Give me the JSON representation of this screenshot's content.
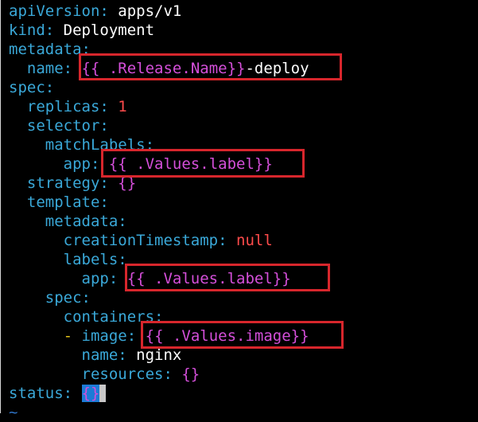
{
  "editor": {
    "lines": [
      {
        "key": "apiVersion",
        "sep": ": ",
        "value": "apps/v1"
      },
      {
        "key": "kind",
        "sep": ": ",
        "value": "Deployment"
      },
      {
        "key": "metadata",
        "sep": ":"
      },
      {
        "indent": "  ",
        "key": "name",
        "sep": ": ",
        "tpl": "{{ .Release.Name}}",
        "suffix": "-deploy"
      },
      {
        "key": "spec",
        "sep": ":"
      },
      {
        "indent": "  ",
        "key": "replicas",
        "sep": ": ",
        "num": "1"
      },
      {
        "indent": "  ",
        "key": "selector",
        "sep": ":"
      },
      {
        "indent": "    ",
        "key": "matchLabels",
        "sep": ":"
      },
      {
        "indent": "      ",
        "key": "app",
        "sep": ": ",
        "tpl": "{{ .Values.label}}"
      },
      {
        "indent": "  ",
        "key": "strategy",
        "sep": ": ",
        "braces": "{}"
      },
      {
        "indent": "  ",
        "key": "template",
        "sep": ":"
      },
      {
        "indent": "    ",
        "key": "metadata",
        "sep": ":"
      },
      {
        "indent": "      ",
        "key": "creationTimestamp",
        "sep": ": ",
        "nullval": "null"
      },
      {
        "indent": "      ",
        "key": "labels",
        "sep": ":"
      },
      {
        "indent": "        ",
        "key": "app",
        "sep": ": ",
        "tpl": "{{ .Values.label}}"
      },
      {
        "indent": "    ",
        "key": "spec",
        "sep": ":"
      },
      {
        "indent": "      ",
        "key": "containers",
        "sep": ":"
      },
      {
        "indent": "      ",
        "dash": "- ",
        "key": "image",
        "sep": ": ",
        "tpl": "{{ .Values.image}}"
      },
      {
        "indent": "        ",
        "key": "name",
        "sep": ": ",
        "value": "nginx"
      },
      {
        "indent": "        ",
        "key": "resources",
        "sep": ": ",
        "braces": "{}"
      },
      {
        "key": "status",
        "sep": ": ",
        "cursor": "{}"
      },
      {
        "tilde": "~"
      }
    ]
  },
  "colors": {
    "background": "#000000",
    "key": "#3aa8d8",
    "template_brace": "#d44fd9",
    "number_and_null": "#ff4b4b",
    "list_dash": "#e4c31a",
    "highlight_box": "#d7262c",
    "cursor": "#1c7bd6",
    "empty_line_marker": "#2f74c7"
  }
}
